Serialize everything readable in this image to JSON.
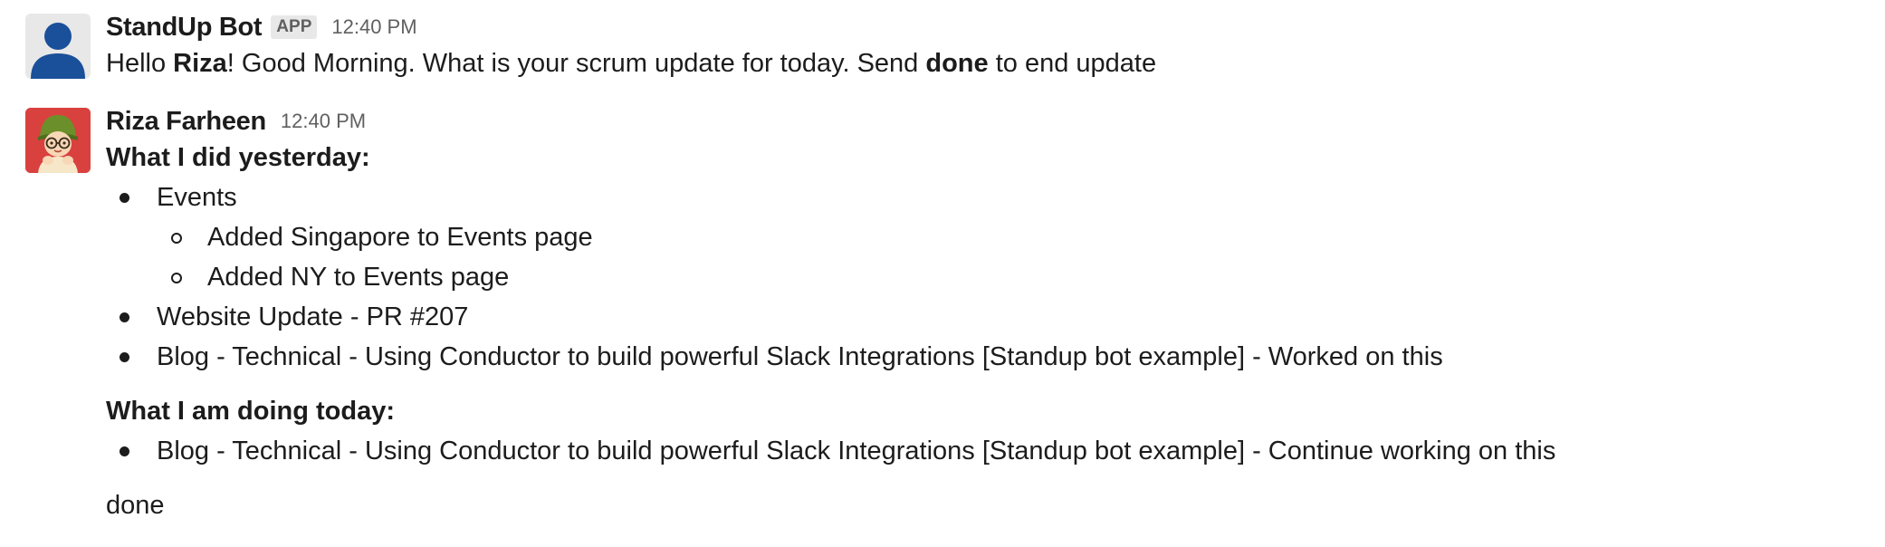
{
  "messages": [
    {
      "sender": "StandUp Bot",
      "badge": "APP",
      "time": "12:40 PM",
      "avatar_icon": "default-user-icon",
      "text_parts": [
        "Hello ",
        "Riza",
        "! Good Morning. What is your scrum update for today. Send ",
        "done",
        " to end update"
      ]
    },
    {
      "sender": "Riza Farheen",
      "time": "12:40 PM",
      "avatar_icon": "cartoon-avatar-icon",
      "yesterday_title": "What I did yesterday:",
      "yesterday_items": [
        {
          "label": "Events",
          "sub_items": [
            "Added Singapore to Events page",
            "Added NY to Events page"
          ]
        },
        {
          "label": "Website Update - PR #207"
        },
        {
          "label": "Blog - Technical - Using Conductor to build powerful Slack Integrations [Standup bot example] - Worked on this"
        }
      ],
      "today_title": "What I am doing today:",
      "today_items": [
        "Blog - Technical - Using Conductor to build powerful Slack Integrations [Standup bot example] - Continue working on this"
      ],
      "final_text": "done"
    }
  ],
  "colors": {
    "bot_avatar_bg": "#e8e8e8",
    "bot_avatar_figure": "#1a4f9a",
    "user_avatar_bg": "#d9413f",
    "text": "#1d1c1d",
    "muted": "#616061"
  }
}
